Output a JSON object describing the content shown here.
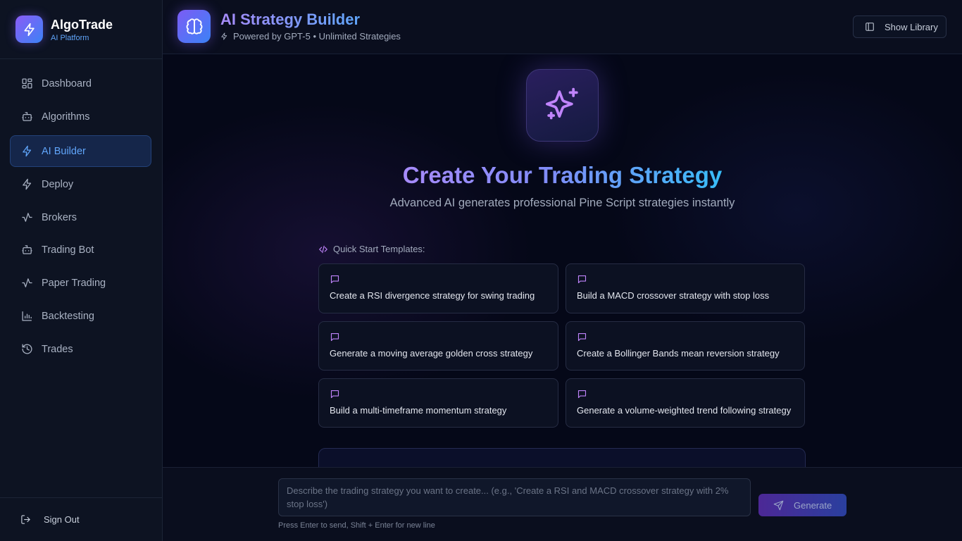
{
  "brand": {
    "name": "AlgoTrade",
    "subtitle": "AI Platform",
    "icon": "lightning-icon"
  },
  "sidebar": {
    "items": [
      {
        "label": "Dashboard",
        "icon": "dashboard-icon",
        "active": false
      },
      {
        "label": "Algorithms",
        "icon": "robot-icon",
        "active": false
      },
      {
        "label": "AI Builder",
        "icon": "lightning-icon",
        "active": true
      },
      {
        "label": "Deploy",
        "icon": "lightning-icon",
        "active": false
      },
      {
        "label": "Brokers",
        "icon": "activity-icon",
        "active": false
      },
      {
        "label": "Trading Bot",
        "icon": "robot-icon",
        "active": false
      },
      {
        "label": "Paper Trading",
        "icon": "activity-icon",
        "active": false
      },
      {
        "label": "Backtesting",
        "icon": "bar-chart-icon",
        "active": false
      },
      {
        "label": "Trades",
        "icon": "history-icon",
        "active": false
      }
    ],
    "sign_out": "Sign Out"
  },
  "header": {
    "title": "AI Strategy Builder",
    "subtitle": "Powered by GPT-5 • Unlimited Strategies",
    "library_button": "Show Library"
  },
  "hero": {
    "title": "Create Your Trading Strategy",
    "subtitle": "Advanced AI generates professional Pine Script strategies instantly"
  },
  "quick_start": {
    "label": "Quick Start Templates:",
    "templates": [
      "Create a RSI divergence strategy for swing trading",
      "Build a MACD crossover strategy with stop loss",
      "Generate a moving average golden cross strategy",
      "Create a Bollinger Bands mean reversion strategy",
      "Build a multi-timeframe momentum strategy",
      "Generate a volume-weighted trend following strategy"
    ]
  },
  "composer": {
    "placeholder": "Describe the trading strategy you want to create... (e.g., 'Create a RSI and MACD crossover strategy with 2% stop loss')",
    "generate_label": "Generate",
    "hint": "Press Enter to send, Shift + Enter for new line"
  },
  "colors": {
    "accent_purple": "#8b5cf6",
    "accent_blue": "#3b82f6",
    "active_nav_text": "#60a5fa",
    "background": "#070a19"
  }
}
